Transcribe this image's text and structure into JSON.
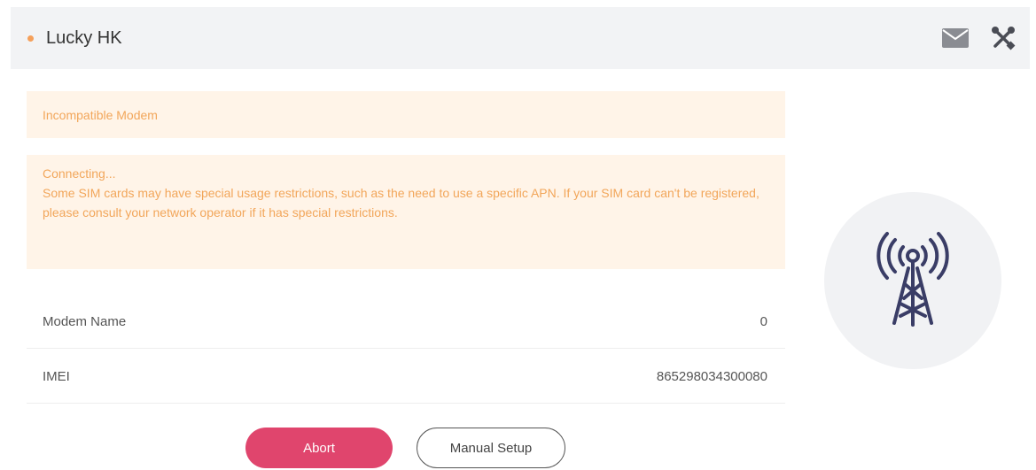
{
  "header": {
    "title": "Lucky HK",
    "status_color": "#f5a05a",
    "icons": [
      "mail-icon",
      "tools-icon"
    ]
  },
  "alerts": {
    "incompatible": "Incompatible Modem",
    "connecting_title": "Connecting...",
    "connecting_message": "Some SIM cards may have special usage restrictions, such as the need to use a specific APN. If your SIM card can't be registered, please consult your network operator if it has special restrictions."
  },
  "info": {
    "modem_name_label": "Modem Name",
    "modem_name_value": "0",
    "imei_label": "IMEI",
    "imei_value": "865298034300080"
  },
  "actions": {
    "abort_label": "Abort",
    "manual_setup_label": "Manual Setup"
  },
  "colors": {
    "accent": "#e0456d",
    "alert_text": "#f2a65a",
    "alert_bg": "#fff4e8",
    "tower_icon": "#3a3d66"
  }
}
